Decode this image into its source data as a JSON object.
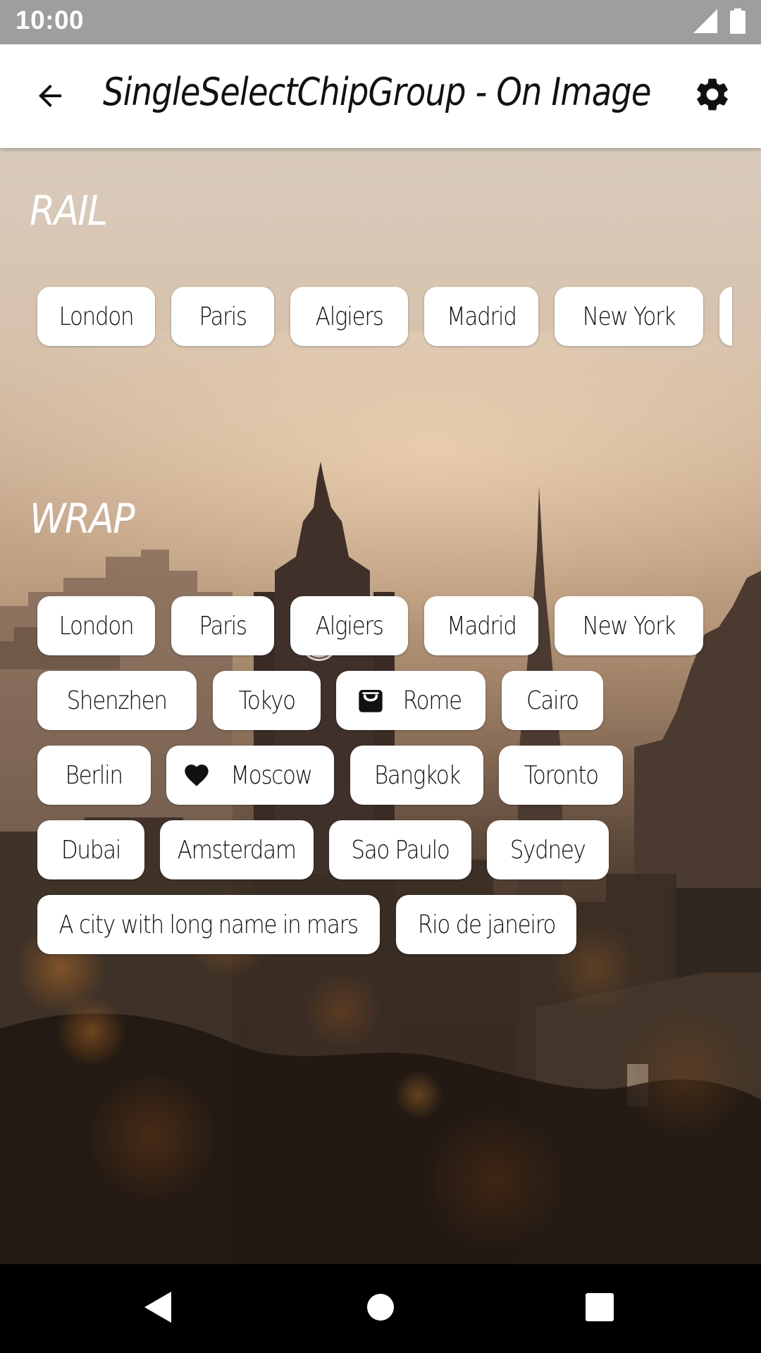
{
  "status_bar": {
    "time": "10:00"
  },
  "app_bar": {
    "title": "SingleSelectChipGroup - On Image"
  },
  "sections": {
    "rail": {
      "label": "RAIL"
    },
    "wrap": {
      "label": "WRAP"
    }
  },
  "rail_chips": [
    {
      "label": "London"
    },
    {
      "label": "Paris"
    },
    {
      "label": "Algiers"
    },
    {
      "label": "Madrid"
    },
    {
      "label": "New York"
    }
  ],
  "wrap_chips": [
    {
      "label": "London"
    },
    {
      "label": "Paris"
    },
    {
      "label": "Algiers"
    },
    {
      "label": "Madrid"
    },
    {
      "label": "New York"
    },
    {
      "label": "Shenzhen"
    },
    {
      "label": "Tokyo"
    },
    {
      "label": "Rome",
      "icon": "shopping-bag-icon"
    },
    {
      "label": "Cairo"
    },
    {
      "label": "Berlin"
    },
    {
      "label": "Moscow",
      "icon": "heart-icon"
    },
    {
      "label": "Bangkok"
    },
    {
      "label": "Toronto"
    },
    {
      "label": "Dubai"
    },
    {
      "label": "Amsterdam"
    },
    {
      "label": "Sao Paulo"
    },
    {
      "label": "Sydney"
    },
    {
      "label": "A city with long name in mars"
    },
    {
      "label": "Rio de janeiro"
    }
  ]
}
